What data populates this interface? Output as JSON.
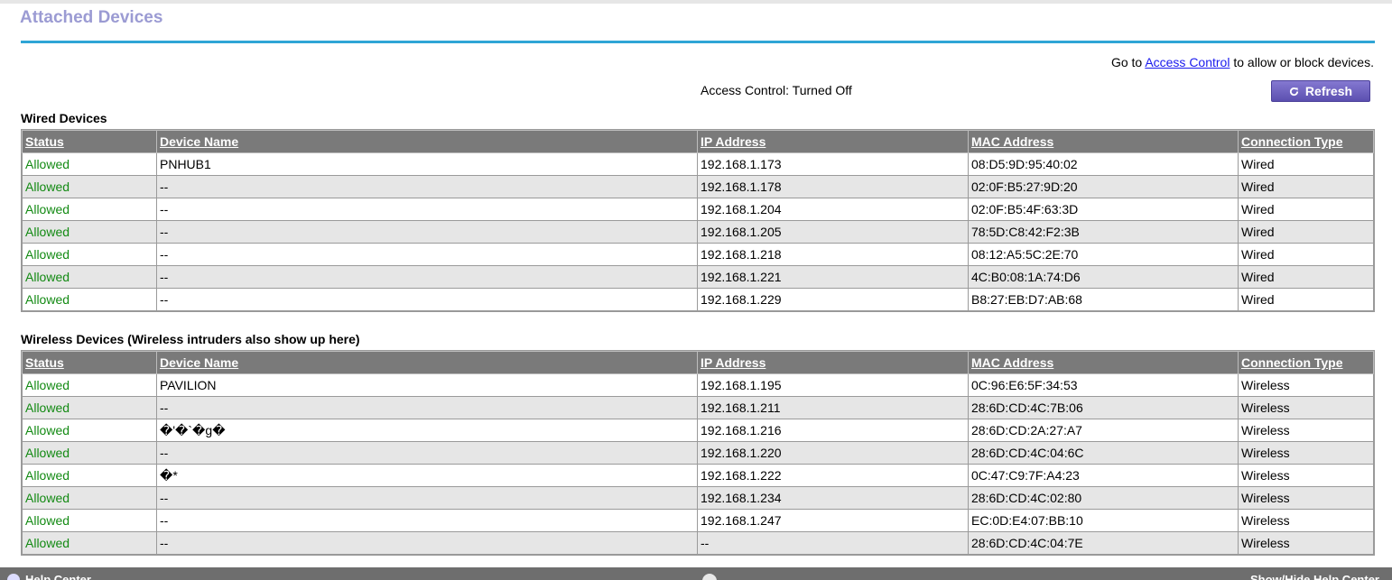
{
  "page": {
    "title": "Attached Devices",
    "goto_prefix": "Go to ",
    "access_control_link": "Access Control",
    "goto_suffix": " to allow or block devices.",
    "access_control_status": "Access Control: Turned Off",
    "refresh_label": "Refresh"
  },
  "columns": [
    "Status",
    "Device Name",
    "IP Address",
    "MAC Address",
    "Connection Type"
  ],
  "wired": {
    "title": "Wired Devices",
    "rows": [
      {
        "status": "Allowed",
        "name": "PNHUB1",
        "ip": "192.168.1.173",
        "mac": "08:D5:9D:95:40:02",
        "type": "Wired"
      },
      {
        "status": "Allowed",
        "name": "--",
        "ip": "192.168.1.178",
        "mac": "02:0F:B5:27:9D:20",
        "type": "Wired"
      },
      {
        "status": "Allowed",
        "name": "--",
        "ip": "192.168.1.204",
        "mac": "02:0F:B5:4F:63:3D",
        "type": "Wired"
      },
      {
        "status": "Allowed",
        "name": "--",
        "ip": "192.168.1.205",
        "mac": "78:5D:C8:42:F2:3B",
        "type": "Wired"
      },
      {
        "status": "Allowed",
        "name": "--",
        "ip": "192.168.1.218",
        "mac": "08:12:A5:5C:2E:70",
        "type": "Wired"
      },
      {
        "status": "Allowed",
        "name": "--",
        "ip": "192.168.1.221",
        "mac": "4C:B0:08:1A:74:D6",
        "type": "Wired"
      },
      {
        "status": "Allowed",
        "name": "--",
        "ip": "192.168.1.229",
        "mac": "B8:27:EB:D7:AB:68",
        "type": "Wired"
      }
    ]
  },
  "wireless": {
    "title": "Wireless Devices (Wireless intruders also show up here)",
    "rows": [
      {
        "status": "Allowed",
        "name": "PAVILION",
        "ip": "192.168.1.195",
        "mac": "0C:96:E6:5F:34:53",
        "type": "Wireless"
      },
      {
        "status": "Allowed",
        "name": "--",
        "ip": "192.168.1.211",
        "mac": "28:6D:CD:4C:7B:06",
        "type": "Wireless"
      },
      {
        "status": "Allowed",
        "name": "�'�`�g�",
        "ip": "192.168.1.216",
        "mac": "28:6D:CD:2A:27:A7",
        "type": "Wireless"
      },
      {
        "status": "Allowed",
        "name": "--",
        "ip": "192.168.1.220",
        "mac": "28:6D:CD:4C:04:6C",
        "type": "Wireless"
      },
      {
        "status": "Allowed",
        "name": "�*",
        "ip": "192.168.1.222",
        "mac": "0C:47:C9:7F:A4:23",
        "type": "Wireless"
      },
      {
        "status": "Allowed",
        "name": "--",
        "ip": "192.168.1.234",
        "mac": "28:6D:CD:4C:02:80",
        "type": "Wireless"
      },
      {
        "status": "Allowed",
        "name": "--",
        "ip": "192.168.1.247",
        "mac": "EC:0D:E4:07:BB:10",
        "type": "Wireless"
      },
      {
        "status": "Allowed",
        "name": "--",
        "ip": "--",
        "mac": "28:6D:CD:4C:04:7E",
        "type": "Wireless"
      }
    ]
  },
  "bottom_bar": {
    "help_center": "Help Center",
    "toggle_help": "Show/Hide Help Center"
  },
  "colors": {
    "title": "#9b9bd3",
    "rule": "#2fa5d6",
    "header_bg": "#7a7a7a",
    "allowed": "#138a13",
    "link": "#1a1aee",
    "button": "#6a5fc0"
  }
}
